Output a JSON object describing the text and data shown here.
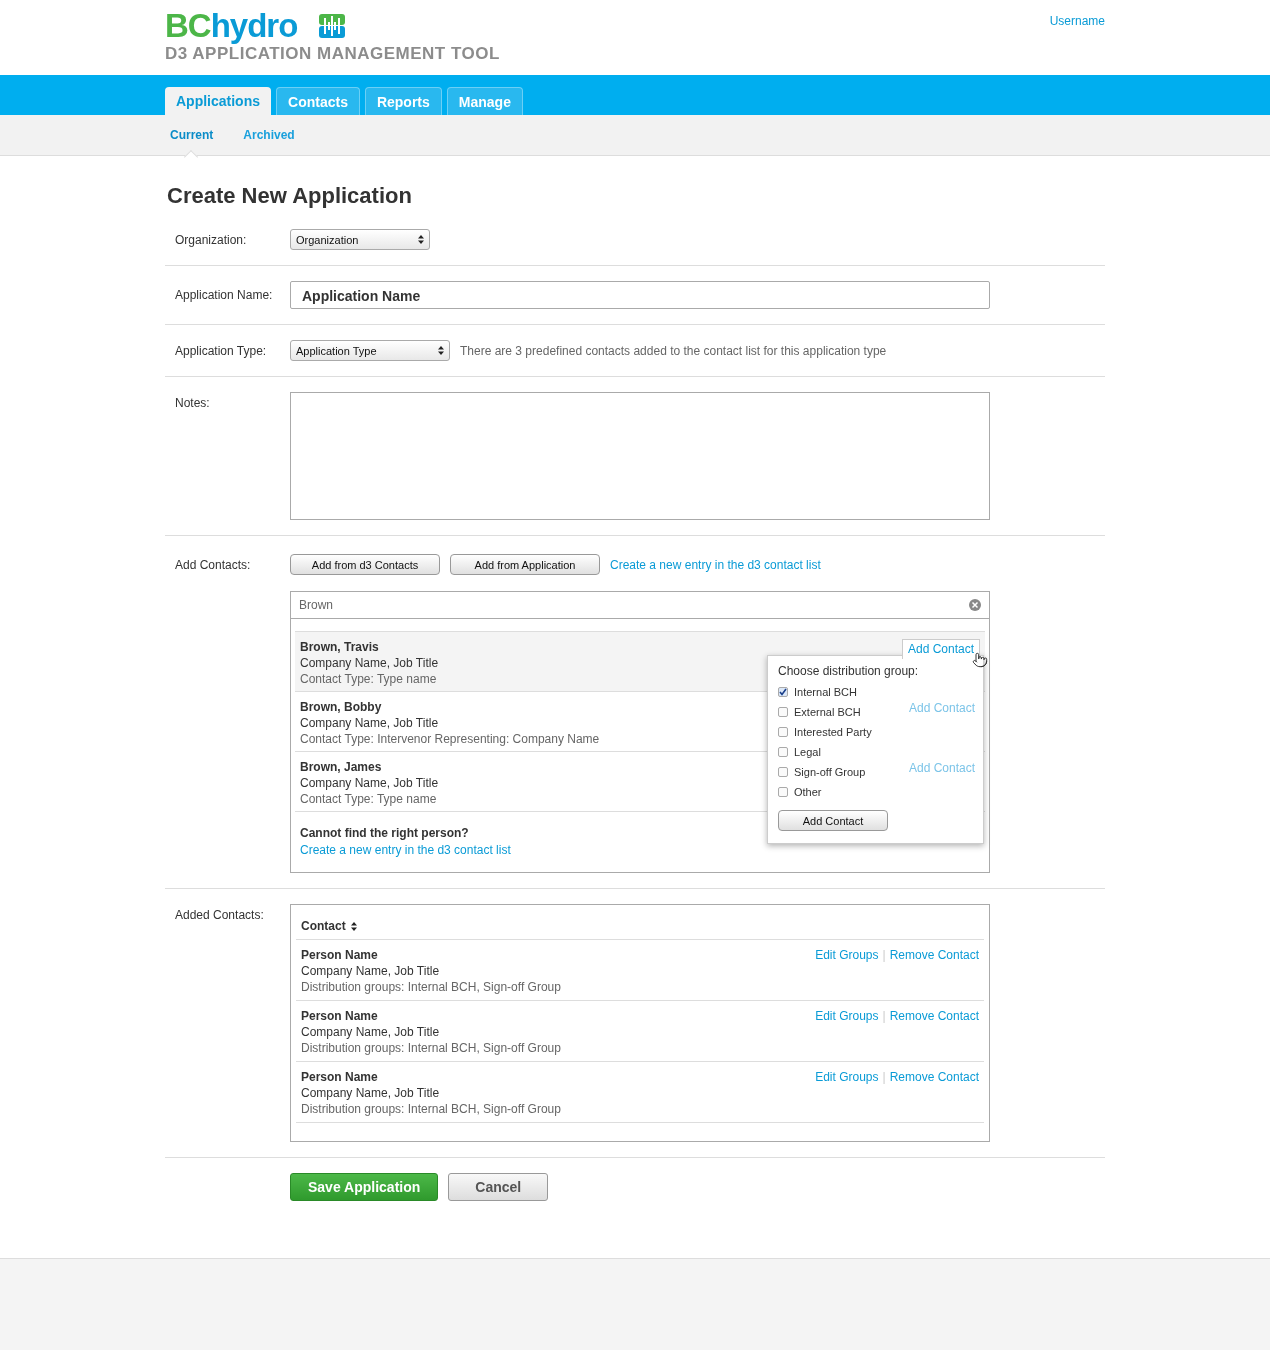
{
  "header": {
    "brand_primary": "BC",
    "brand_secondary": "hydro",
    "subtitle": "D3 APPLICATION MANAGEMENT TOOL",
    "user_link": "Username"
  },
  "nav": {
    "tabs": [
      {
        "label": "Applications",
        "selected": true
      },
      {
        "label": "Contacts",
        "selected": false
      },
      {
        "label": "Reports",
        "selected": false
      },
      {
        "label": "Manage",
        "selected": false
      }
    ],
    "subtabs": [
      {
        "label": "Current",
        "selected": true
      },
      {
        "label": "Archived",
        "selected": false
      }
    ]
  },
  "page_title": "Create New Application",
  "form": {
    "organization": {
      "label": "Organization:",
      "value": "Organization"
    },
    "application_name": {
      "label": "Application Name:",
      "value": "Application Name"
    },
    "application_type": {
      "label": "Application Type:",
      "value": "Application Type",
      "hint": "There are 3 predefined contacts added to the contact list for this application type"
    },
    "notes": {
      "label": "Notes:"
    }
  },
  "add_contacts": {
    "label": "Add Contacts:",
    "buttons": [
      "Add from d3 Contacts",
      "Add from Application"
    ],
    "link": "Create a new entry in the d3 contact list",
    "search": {
      "value": "Brown"
    },
    "results": [
      {
        "name": "Brown, Travis",
        "company": "Company Name, Job Title",
        "contact_type": "Contact Type: Type name",
        "action": "Add Contact",
        "highlighted": true
      },
      {
        "name": "Brown, Bobby",
        "company": "Company Name, Job Title",
        "contact_type": "Contact Type: Intervenor Representing: Company Name",
        "action": "Add Contact",
        "highlighted": false
      },
      {
        "name": "Brown, James",
        "company": "Company Name, Job Title",
        "contact_type": "Contact Type: Type name",
        "action": "Add Contact",
        "highlighted": false
      }
    ],
    "not_found": {
      "question": "Cannot find the right person?",
      "link": "Create a new entry in the d3 contact list"
    },
    "popup": {
      "title": "Choose distribution group:",
      "options": [
        {
          "label": "Internal BCH",
          "checked": true
        },
        {
          "label": "External BCH",
          "checked": false
        },
        {
          "label": "Interested Party",
          "checked": false
        },
        {
          "label": "Legal",
          "checked": false
        },
        {
          "label": "Sign-off Group",
          "checked": false
        },
        {
          "label": "Other",
          "checked": false
        }
      ],
      "button": "Add Contact"
    }
  },
  "added_contacts": {
    "label": "Added Contacts:",
    "column_header": "Contact",
    "separator": "|",
    "rows": [
      {
        "name": "Person Name",
        "company": "Company Name, Job Title",
        "groups": "Distribution groups: Internal BCH, Sign-off Group",
        "actions": [
          "Edit Groups",
          "Remove Contact"
        ]
      },
      {
        "name": "Person Name",
        "company": "Company Name, Job Title",
        "groups": "Distribution groups: Internal BCH, Sign-off Group",
        "actions": [
          "Edit Groups",
          "Remove Contact"
        ]
      },
      {
        "name": "Person Name",
        "company": "Company Name, Job Title",
        "groups": "Distribution groups: Internal BCH, Sign-off Group",
        "actions": [
          "Edit Groups",
          "Remove Contact"
        ]
      }
    ]
  },
  "footer_buttons": [
    {
      "label": "Save Application",
      "kind": "primary"
    },
    {
      "label": "Cancel",
      "kind": "secondary"
    }
  ]
}
